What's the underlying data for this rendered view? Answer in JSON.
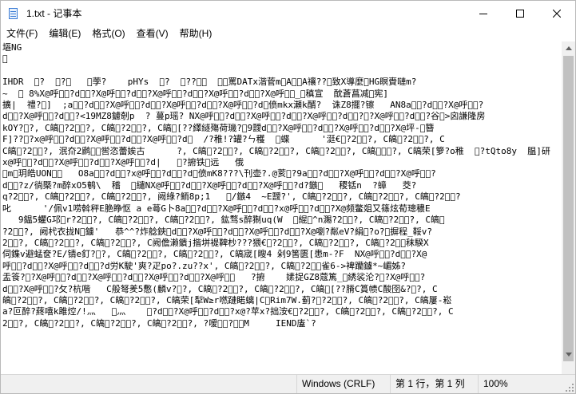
{
  "window": {
    "title": "1.txt - 记事本",
    "controls": {
      "minimize": "minimize-icon",
      "maximize": "maximize-icon",
      "close": "close-icon"
    }
  },
  "menu": [
    {
      "label": "文件(F)"
    },
    {
      "label": "编辑(E)"
    },
    {
      "label": "格式(O)"
    },
    {
      "label": "查看(V)"
    },
    {
      "label": "帮助(H)"
    }
  ],
  "editor": {
    "content": "塸NG\n\u0000\n\nIHDR  \u0000?  \u0000?\u0000   \u0000荸?    pHYs  \u0000?  \u0000??\u0000\u0000  \u0000\u0000罵DATx湝菅m\u0000A\u0000\u0000A禳??\u0000致X導麼\u0000HG瞑賫嗹m?\n~  \u0000 8%X@呼\u0000\u0000?d\u0000\u0000?X@呼\u0000\u0000?d\u0000\u0000?X@呼\u0000\u0000?d\u0000\u0000?X@呼\u0000\u0000?d\u0000\u0000?X@呼\u0000\u0000_\u0000稹宣  酖蒼菖减\u0000宪]\n擴|  禮?\u0000]  ;a\u0000\u0000?d\u0000\u0000?X@呼\u0000\u0000?d\u0000\u0000?X@呼\u0000\u0000?d\u0000\u0000?X@呼\u0000\u0000?d\u0000偾mkx瀬k醑?  诛Z8擺?镲   AN8a\u0000\u0000?d\u0000\u0000?X@呼\u0000\u0000?\nd\u0000\u0000?X@呼\u0000\u0000?d\u0000\u0000?<19MZ8鑢剞p  ? 蔓p瑶? NX@呼\u0000\u0000?d\u0000\u0000?X@呼\u0000\u0000?d\u0000\u0000?X@呼\u0000\u0000?d\u0000\u0000?\u0000?X@呼\u0000\u0000?d\u0000\u0000?谷\u0000>囟謙隆房\nkOY?\u0000?, C皜\u0000?2\u0000\u0000?, C皜\u0000?2\u0000\u0000?, C皜\u0000[??繹繸殤荷璣?\u00009靉d\u0000\u0000?X@呼\u0000\u0000?d\u0000\u0000?X@呼\u0000\u0000?d\u0000\u0000?X@坪-\u0000簪\nF]??\u0000?x@呼\u0000\u0000?d\u0000\u0000?X@呼\u0000\u0000?d\u0000\u0000?X@呼\u0000\u0000?d\u0000  /?稚!?罐?ㄣ穫  \u0000蝶      '涏€\u0000?2\u0000\u0000?, C皜\u0000?2\u0000\u0000?, C\nC皜\u0000?2\u0000\u0000?, 泯夼2䴘\u0000\u0000喾恣蕾娭古      ?, C皜\u0000?2\u0000\u0000?, C皜\u0000?2\u0000\u0000?, C皜\u0000?2\u0000\u0000?, C皜\u0000\u0000\u0000?, C皜荣[箩?o稚  \u0000?tQto8y  腽]研\nx@呼\u0000\u0000?d\u0000\u0000?X@呼\u0000\u0000?d\u0000\u0000?X@呼\u0000\u0000?d|   \u0000?捬铁\u0000远   俄\n\u0000m\u0000玥皓UON\u0000\u0000   O8a\u0000\u0000?d\u0000\u0000?x@呼\u0000\u0000?d\u0000\u0000?d\u0000偾mK8???\\刊壶?.@荄\u0000?9a\u0000\u0000?d\u0000\u0000?X@呼\u0000\u0000?d\u0000\u0000?X@呼\u0000\u0000?\nd\u0000\u0000?z/徜槩?m醉xO5鹌\\  稽  \u0000繾NX@呼\u0000\u0000?d\u0000\u0000?X@呼\u0000\u0000?d\u0000\u0000?X@呼\u0000\u0000?d?鏃\u0000   稷铦n  ?蟑   茭?\nq?2\u0000\u0000?, C皜\u0000?2\u0000\u0000?, C皜\u0000?2\u0000\u0000?, 阙綠?鲕8p;1   \u0000/鏃4  ~E靉?', C皜\u0000?2\u0000\u0000?, C皜\u0000?2\u0000\u0000?, C皜\u0000?2\u0000\u0000?\n叱      '/佩v1唠斡秤E脃睁怄 a e蕚G卜8a\u0000\u0000?d\u0000\u0000?X@呼\u0000\u0000?d\u0000\u0000?x@呼\u0000\u0000?d\u0000\u0000?X@频鳖爼又篠炫荀璁穠E\n   9鎾5蠷G邛\u0000r?2\u0000\u0000?, C皜\u0000?2\u0000\u0000?, C皜\u0000?2\u0000\u0000?, 鈜骛s醉猘uq(W  \u0000緄\u0000^n瀃?2\u0000\u0000?, C皜\u0000?2\u0000\u0000?, C皜\u0000\n?2\u0000\u0000?, 阙杙衣拢N\u0000鐪'   恭^^?炸艌鋏\u0000d\u0000\u0000?X@呼\u0000\u0000?d\u0000\u0000?X@呼\u0000\u0000?d\u0000\u0000?X@嚠?粼eV?絹\u0000?o?\u0000摒程_鞖v?\n2\u0000\u0000?, C皜\u0000?2\u0000\u0000?, C皜\u0000?2\u0000\u0000?, C阙儋濑鐀j揩垪褆鞞杪???猥€\u0000?2\u0000\u0000?, C皜\u0000?2\u0000\u0000?, C皜\u0000?2\u0000\u0000秣騤X\n伺鏶v避蜢奁?E/锖e釘?\u0000?, C皜\u0000?2\u0000\u0000?, C皜\u0000?2\u0000\u0000?, C皜宬[瞍4 剁9筈匮[患m-?F  NX@呼\u0000\u0000?d\u0000\u0000?X@\n呼\u0000\u0000?d\u0000\u0000?X@呼\u0000\u0000?d\u0000\u0000?d労K駛'爽?疋po?.zu??x', C皜\u0000?2\u0000\u0000?, C皜\u0000?2\u0000\u0000雀6->裨躪鐪*~嵋姊?\n盂篒?\u0000?X@呼\u0000\u0000?d\u0000\u0000?X@呼\u0000\u0000?d\u0000\u0000?X@呼\u0000\u0000?d\u0000\u0000?X@呼\u0000\u0000   ?捬    嫊捉GZ8蔻篤_\u0000綉裟沦?\u0000?X@呼\u0000\u0000?\nd\u0000\u0000?X@呼\u0000\u0000?攵?杭喈   C般弩羑5懯(麟v?\u0000?, C皜\u0000?2\u0000\u0000?, C皜\u0000?2\u0000\u0000?, C皜\u0000[??膌C篔帻C酸囹&?\u0000?, C\n皜\u0000?2\u0000\u0000?, C皜\u0000?2\u0000\u0000?, C皜\u0000?2\u0000\u0000?, C皜荣[犁W≥r嘫蹥睰螭|C\u0000Rim7W.蓟?\u0000?2\u0000\u0000?, C皜\u0000?2\u0000\u0000?, C皜屢-崧\na?叵醉?蔠嘻k雎焢/!灬   \u0000灬    \u0000?d\u0000\u0000?X@呼\u0000\u0000?d\u0000\u0000?x@?苹x?拙洝€\u0000?2\u0000\u0000?, C皜\u0000?2\u0000\u0000?, C皜\u0000?2\u0000\u0000?, C\n2\u0000\u0000?, C皜\u0000?2\u0000\u0000?, C皜\u0000?2\u0000\u0000?, C皜\u0000?2\u0000\u0000?, ?嗳\u0000\u0000?\u0000\u0000M     IEND廅`?"
  },
  "status": {
    "line_ending": "Windows (CRLF)",
    "position": "第 1 行，第 1 列",
    "zoom": "100%"
  }
}
